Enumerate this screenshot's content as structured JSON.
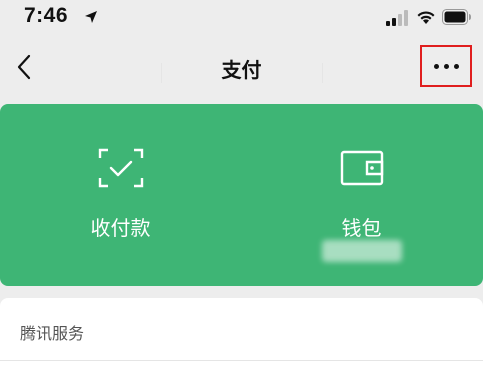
{
  "status_bar": {
    "time": "7:46",
    "icons": [
      "location-arrow-icon",
      "cellular-signal-icon",
      "wifi-icon",
      "battery-icon"
    ]
  },
  "nav": {
    "title": "支付",
    "back_icon": "chevron-left-icon",
    "more_icon": "more-dots-icon"
  },
  "pay_card": {
    "color": "#3eb575",
    "items": [
      {
        "label": "收付款",
        "icon": "scan-check-icon"
      },
      {
        "label": "钱包",
        "icon": "wallet-icon"
      }
    ]
  },
  "services": {
    "title": "腾讯服务"
  },
  "colors": {
    "background": "#ededed",
    "highlight_border": "#e01e1e"
  }
}
